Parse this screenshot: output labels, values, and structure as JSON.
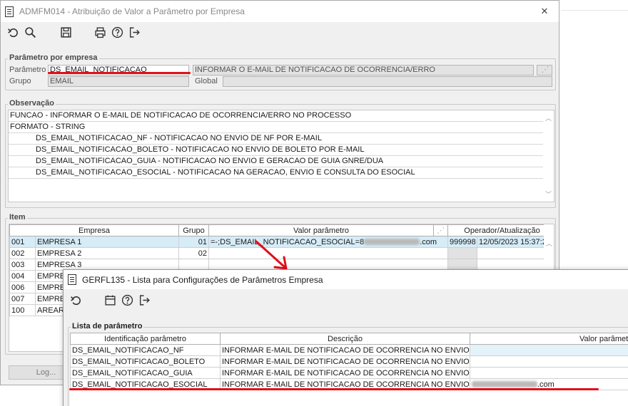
{
  "back_window": {
    "title": "ADMFM014 - Atribuição de Valor a Parâmetro por Empresa",
    "close_label": "✕",
    "toolbar": [
      "undo-icon",
      "search-icon",
      "save-icon",
      "print-icon",
      "help-icon",
      "exit-icon"
    ],
    "param_group": {
      "title": "Parâmetro por empresa",
      "parametro_label": "Parâmetro",
      "parametro_value": "DS_EMAIL_NOTIFICACAO",
      "descricao_value": "INFORMAR O E-MAIL DE NOTIFICACAO DE OCORRENCIA/ERRO",
      "grupo_label": "Grupo",
      "grupo_value": "EMAIL",
      "global_label": "Global",
      "global_value": ""
    },
    "observacao": {
      "title": "Observação",
      "lines": [
        "FUNCAO - INFORMAR O E-MAIL DE NOTIFICACAO DE OCORRENCIA/ERRO NO PROCESSO",
        "FORMATO - STRING",
        "DS_EMAIL_NOTIFICACAO_NF - NOTIFICACAO NO ENVIO DE NF POR E-MAIL",
        "DS_EMAIL_NOTIFICACAO_BOLETO - NOTIFICACAO NO ENVIO DE BOLETO POR E-MAIL",
        "DS_EMAIL_NOTIFICACAO_GUIA - NOTIFICACAO NO ENVIO E GERACAO DE GUIA GNRE/DUA",
        "DS_EMAIL_NOTIFICACAO_ESOCIAL - NOTIFICACAO NA GERACAO, ENVIO E CONSULTA DO ESOCIAL"
      ]
    },
    "item": {
      "title": "Item",
      "headers": [
        "Empresa",
        "Grupo",
        "Valor parâmetro",
        "Operador/Atualização"
      ],
      "rows": [
        {
          "code": "001",
          "name": "EMPRESA 1",
          "grupo": "01",
          "valor_prefix": "=-;DS_EMAIL_NOTIFICACAO_ESOCIAL=8",
          "valor_suffix": ".com",
          "operador": "999998",
          "atualizacao": "12/05/2023 15:37:29"
        },
        {
          "code": "002",
          "name": "EMPRESA 2",
          "grupo": "02",
          "valor_prefix": "",
          "valor_suffix": "",
          "operador": "",
          "atualizacao": ""
        },
        {
          "code": "003",
          "name": "EMPRESA 3",
          "grupo": "",
          "valor_prefix": "",
          "valor_suffix": "",
          "operador": "",
          "atualizacao": ""
        },
        {
          "code": "004",
          "name": "EMPRES",
          "grupo": "",
          "valor_prefix": "",
          "valor_suffix": "",
          "operador": "",
          "atualizacao": ""
        },
        {
          "code": "006",
          "name": "EMPRES",
          "grupo": "",
          "valor_prefix": "",
          "valor_suffix": "",
          "operador": "",
          "atualizacao": ""
        },
        {
          "code": "007",
          "name": "EMPRES",
          "grupo": "",
          "valor_prefix": "",
          "valor_suffix": "",
          "operador": "",
          "atualizacao": ""
        },
        {
          "code": "100",
          "name": "AREARO",
          "grupo": "",
          "valor_prefix": "",
          "valor_suffix": "",
          "operador": "",
          "atualizacao": ""
        }
      ]
    },
    "log_button": "Log..."
  },
  "front_window": {
    "title": "GERFL135 - Lista para Configurações de Parâmetros Empresa",
    "toolbar": [
      "undo-icon",
      "calendar-icon",
      "help-icon",
      "exit-icon"
    ],
    "lista": {
      "title": "Lista de parâmetro",
      "headers": [
        "Identificação parâmetro",
        "Descrição",
        "Valor parâmetro"
      ],
      "rows": [
        {
          "id": "DS_EMAIL_NOTIFICACAO_NF",
          "descricao": "INFORMAR E-MAIL DE NOTIFICACAO DE OCORRENCIA NO ENVIO DE NF",
          "valor_suffix": ""
        },
        {
          "id": "DS_EMAIL_NOTIFICACAO_BOLETO",
          "descricao": "INFORMAR E-MAIL DE NOTIFICACAO DE OCORRENCIA NO ENVIO DE BC",
          "valor_suffix": ""
        },
        {
          "id": "DS_EMAIL_NOTIFICACAO_GUIA",
          "descricao": "INFORMAR E-MAIL DE NOTIFICACAO DE OCORRENCIA NO ENVIO DA GN",
          "valor_suffix": ""
        },
        {
          "id": "DS_EMAIL_NOTIFICACAO_ESOCIAL",
          "descricao": "INFORMAR E-MAIL DE NOTIFICACAO DE OCORRENCIA NO ENVIO DO ES",
          "valor_suffix": ".com"
        }
      ]
    }
  },
  "colors": {
    "annotation_red": "#e0101a",
    "selected_row": "#d6ecf7",
    "window_bg": "#f0f0f0"
  }
}
